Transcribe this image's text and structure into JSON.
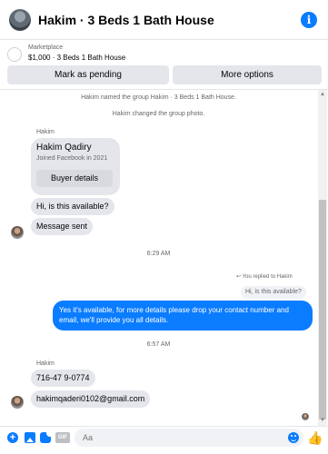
{
  "header": {
    "title": "Hakim · 3 Beds 1 Bath House",
    "info_icon_glyph": "i"
  },
  "marketplace": {
    "label": "Marketplace",
    "item": "$1,000 · 3 Beds 1 Bath House"
  },
  "actions": {
    "mark_pending": "Mark as pending",
    "more_options": "More options"
  },
  "thread": {
    "system_messages": [
      "Hakim named the group Hakim · 3 Beds 1 Bath House.",
      "Hakim changed the group photo."
    ],
    "sender_1": "Hakim",
    "profile_card": {
      "name": "Hakim Qadiry",
      "joined": "Joined Facebook in 2021",
      "button": "Buyer details"
    },
    "incoming_1": "Hi, is this available?",
    "incoming_2": "Message sent",
    "timestamp_1": "6:29 AM",
    "replied_label": "You replied to Hakim",
    "replied_quote": "Hi, is this available?",
    "outgoing_1": "Yes it's available, for more details please drop your contact number and email, we'll provide you all details.",
    "timestamp_2": "6:57 AM",
    "sender_2": "Hakim",
    "incoming_3": "716-47 9-0774",
    "incoming_4": "hakimqaderi0102@gmail.com"
  },
  "composer": {
    "placeholder": "Aa",
    "plus_glyph": "+",
    "gif_label": "GIF",
    "like_glyph": "👍"
  },
  "colors": {
    "accent": "#0a7cff",
    "bubble_incoming": "#e4e6eb",
    "secondary_text": "#65676b"
  }
}
